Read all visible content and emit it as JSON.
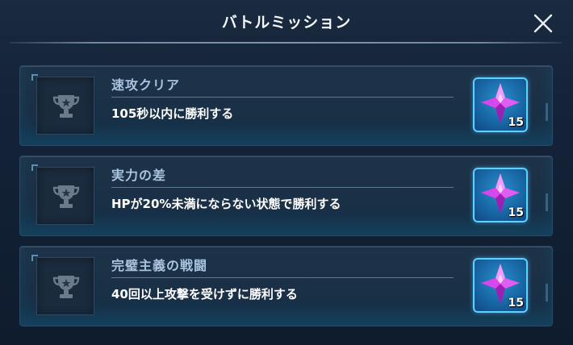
{
  "header": {
    "title": "バトルミッション"
  },
  "missions": [
    {
      "title": "速攻クリア",
      "description": "105秒以内に勝利する",
      "reward_qty": "15"
    },
    {
      "title": "実力の差",
      "description": "HPが20%未満にならない状態で勝利する",
      "reward_qty": "15"
    },
    {
      "title": "完璧主義の戦闘",
      "description": "40回以上攻撃を受けずに勝利する",
      "reward_qty": "15"
    }
  ],
  "icons": {
    "close": "close-icon",
    "trophy": "trophy-icon",
    "reward": "crystal-gem-icon"
  },
  "colors": {
    "gem": "#e23cf0",
    "reward_border": "#5fd0ff",
    "mission_title": "#a9c4e0"
  }
}
